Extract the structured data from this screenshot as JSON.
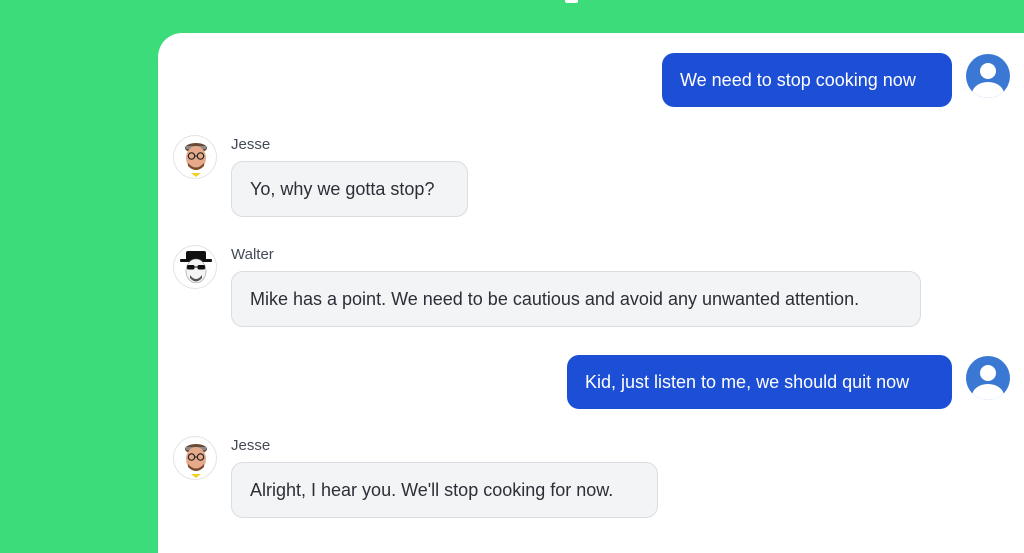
{
  "colors": {
    "background": "#3ddc7a",
    "panel": "#ffffff",
    "outgoing_bubble": "#1d4fd6",
    "incoming_bubble": "#f3f4f6",
    "user_avatar": "#3b78d4"
  },
  "messages": [
    {
      "direction": "outgoing",
      "text": "We need to stop cooking now",
      "avatar": "user-avatar-icon"
    },
    {
      "direction": "incoming",
      "sender": "Jesse",
      "text": "Yo, why we gotta stop?",
      "avatar": "jesse-avatar-icon"
    },
    {
      "direction": "incoming",
      "sender": "Walter",
      "text": "Mike has a point. We need to be cautious and avoid any unwanted attention.",
      "avatar": "walter-avatar-icon"
    },
    {
      "direction": "outgoing",
      "text": "Kid, just listen to me, we should quit now",
      "avatar": "user-avatar-icon"
    },
    {
      "direction": "incoming",
      "sender": "Jesse",
      "text": "Alright, I hear you. We'll stop cooking for now.",
      "avatar": "jesse-avatar-icon"
    }
  ]
}
